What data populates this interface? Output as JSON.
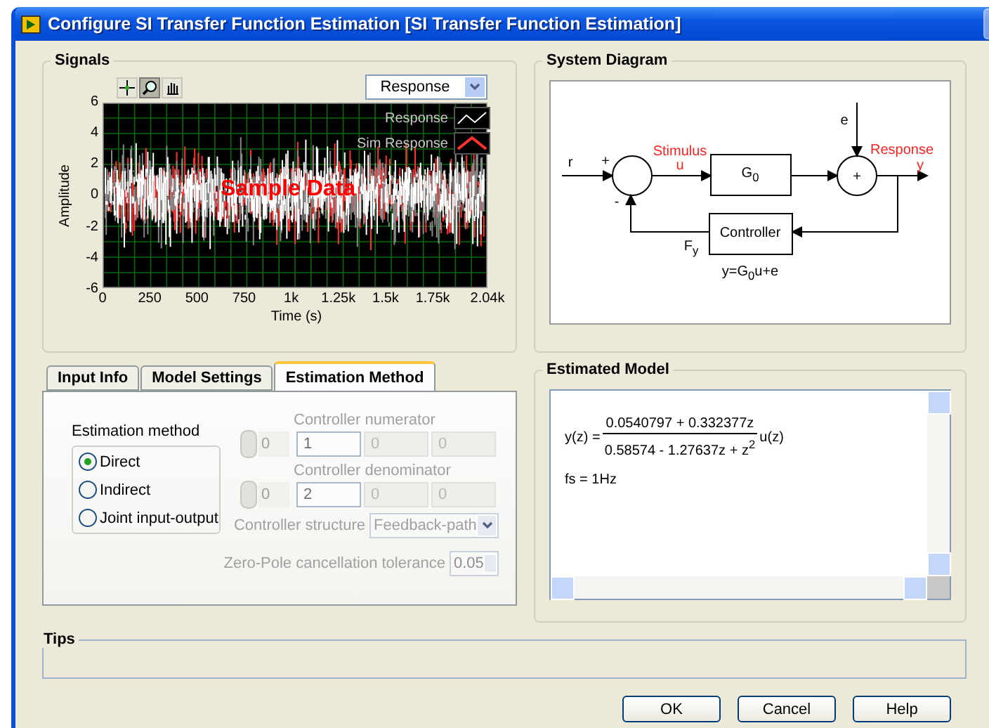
{
  "window": {
    "title": "Configure SI Transfer Function Estimation [SI Transfer Function Estimation]"
  },
  "signals": {
    "title": "Signals",
    "plot_tools": [
      {
        "kind": "cursor",
        "selected": false
      },
      {
        "kind": "zoom",
        "selected": true
      },
      {
        "kind": "pan",
        "selected": false
      }
    ],
    "signal_select": "Response",
    "y_label": "Amplitude",
    "x_label": "Time (s)",
    "y_ticks": [
      "6",
      "4",
      "2",
      "0",
      "-2",
      "-4",
      "-6"
    ],
    "x_ticks": [
      "0",
      "250",
      "500",
      "750",
      "1k",
      "1.25k",
      "1.5k",
      "1.75k",
      "2.04k"
    ],
    "overlay_text": "Sample Data",
    "legend": [
      {
        "label": "Response",
        "color": "#ffffff"
      },
      {
        "label": "Sim Response",
        "color": "#ff3030"
      }
    ]
  },
  "system_diagram": {
    "title": "System Diagram",
    "labels": {
      "r": "r",
      "plus": "+",
      "minus": "-",
      "stimulus": "Stimulus",
      "u": "u",
      "plant": "G$_{0}$",
      "sum": "+",
      "e": "e",
      "response": "Response",
      "y": "y",
      "controller": "Controller",
      "feedback": "F$_{y}$",
      "equation": "y=G$_{0}$u+e"
    }
  },
  "tabs": [
    {
      "label": "Input Info",
      "selected": false
    },
    {
      "label": "Model Settings",
      "selected": false
    },
    {
      "label": "Estimation Method",
      "selected": true
    }
  ],
  "estimation_method": {
    "title": "Estimation method",
    "options": [
      {
        "label": "Direct",
        "selected": true
      },
      {
        "label": "Indirect",
        "selected": false
      },
      {
        "label": "Joint input-output",
        "selected": false
      }
    ],
    "controller_numerator": {
      "label": "Controller numerator",
      "index": "0",
      "values": [
        "1",
        "0",
        "0"
      ],
      "disabled": true
    },
    "controller_denominator": {
      "label": "Controller denominator",
      "index": "0",
      "values": [
        "2",
        "0",
        "0"
      ],
      "disabled": true
    },
    "controller_structure": {
      "label": "Controller structure",
      "value": "Feedback-path",
      "disabled": true
    },
    "tolerance": {
      "label": "Zero-Pole cancellation tolerance",
      "value": "0.05",
      "disabled": true
    }
  },
  "estimated_model": {
    "title": "Estimated Model",
    "lhs": "y(z) =",
    "numerator": "0.0540797 + 0.332377z",
    "denominator": "0.58574 - 1.27637z + z$^{2}$",
    "rhs": "u(z)",
    "sampling": "fs = 1Hz"
  },
  "tips": {
    "title": "Tips"
  },
  "buttons": [
    "OK",
    "Cancel",
    "Help"
  ]
}
